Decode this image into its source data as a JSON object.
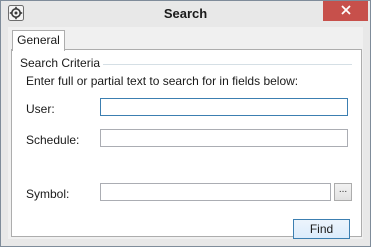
{
  "window": {
    "title": "Search",
    "app_icon": "gear-icon",
    "close_icon": "close-icon"
  },
  "tabs": [
    {
      "label": "General",
      "selected": true
    }
  ],
  "search_criteria": {
    "group_label": "Search Criteria",
    "instruction": "Enter full or partial text to search for in fields below:",
    "fields": {
      "user": {
        "label": "User:",
        "value": ""
      },
      "schedule": {
        "label": "Schedule:",
        "value": ""
      },
      "symbol": {
        "label": "Symbol:",
        "value": "",
        "browse_label": "..."
      }
    }
  },
  "actions": {
    "find_label": "Find"
  },
  "colors": {
    "close_button": "#c7504b",
    "focus_border": "#3c7fb1",
    "chrome": "#e8e8e8",
    "panel": "#ffffff"
  }
}
